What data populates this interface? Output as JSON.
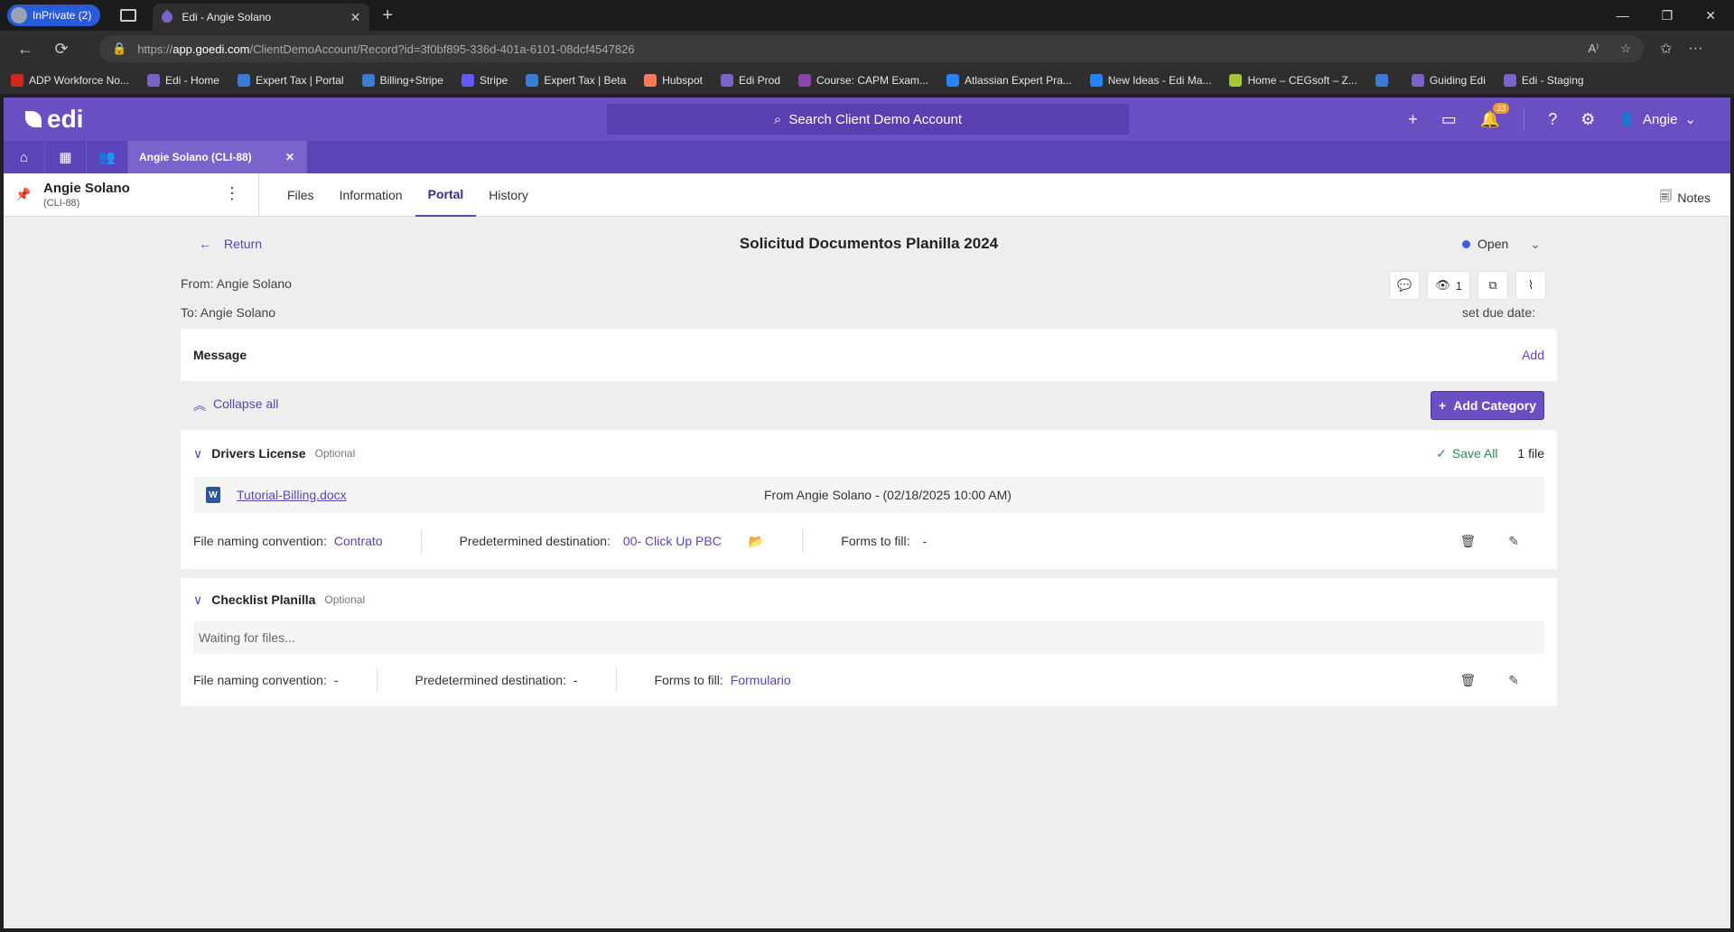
{
  "browser": {
    "inprivate_label": "InPrivate (2)",
    "tab_title": "Edi - Angie Solano",
    "url_scheme": "https://",
    "url_host": "app.goedi.com",
    "url_path": "/ClientDemoAccount/Record?id=3f0bf895-336d-401a-6101-08dcf4547826"
  },
  "bookmarks": [
    {
      "label": "ADP Workforce No...",
      "color": "#d0271d"
    },
    {
      "label": "Edi - Home",
      "color": "#7a64c9"
    },
    {
      "label": "Expert Tax | Portal",
      "color": "#3a7bd5"
    },
    {
      "label": "Billing+Stripe",
      "color": "#3a7bd5"
    },
    {
      "label": "Stripe",
      "color": "#635bff"
    },
    {
      "label": "Expert Tax | Beta",
      "color": "#3a7bd5"
    },
    {
      "label": "Hubspot",
      "color": "#ff7a59"
    },
    {
      "label": "Edi Prod",
      "color": "#7a64c9"
    },
    {
      "label": "Course: CAPM Exam...",
      "color": "#8e44ad"
    },
    {
      "label": "Atlassian Expert Pra...",
      "color": "#2684ff"
    },
    {
      "label": "New Ideas - Edi Ma...",
      "color": "#2684ff"
    },
    {
      "label": "Home – CEGsoft – Z...",
      "color": "#a4c639"
    },
    {
      "label": "",
      "color": "#3a7bd5"
    },
    {
      "label": "Guiding Edi",
      "color": "#7a64c9"
    },
    {
      "label": "Edi - Staging",
      "color": "#7a64c9"
    }
  ],
  "app": {
    "logo": "edi",
    "search_placeholder": "Search Client Demo Account",
    "notification_count": "33",
    "user_name": "Angie",
    "record_tab": "Angie Solano (CLI-88)"
  },
  "record": {
    "name": "Angie Solano",
    "id": "(CLI-88)",
    "tabs": [
      "Files",
      "Information",
      "Portal",
      "History"
    ],
    "active_tab": "Portal",
    "notes_label": "Notes"
  },
  "request": {
    "return_label": "Return",
    "title": "Solicitud Documentos Planilla 2024",
    "status": "Open",
    "from": "From: Angie Solano",
    "to": "To: Angie Solano",
    "views": "1",
    "due_label": "set due date:",
    "message_label": "Message",
    "message_add": "Add",
    "collapse_label": "Collapse all",
    "add_category_label": "Add Category"
  },
  "categories": [
    {
      "name": "Drivers License",
      "optional": "Optional",
      "save_all": "Save All",
      "file_count": "1 file",
      "file_name": "Tutorial-Billing.docx",
      "file_from": "From Angie Solano  -  (02/18/2025 10:00 AM)",
      "naming_label": "File naming convention:",
      "naming_value": "Contrato",
      "dest_label": "Predetermined destination:",
      "dest_value": "00- Click Up PBC",
      "forms_label": "Forms to fill:",
      "forms_value": "-"
    },
    {
      "name": "Checklist Planilla",
      "optional": "Optional",
      "waiting": "Waiting for files...",
      "naming_label": "File naming convention:",
      "naming_value": "-",
      "dest_label": "Predetermined destination:",
      "dest_value": "-",
      "forms_label": "Forms to fill:",
      "forms_value": "Formulario"
    }
  ]
}
